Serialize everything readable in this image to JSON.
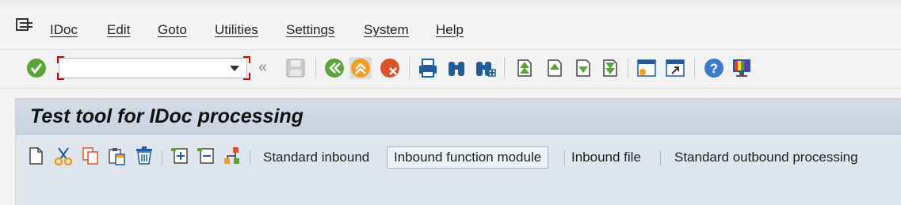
{
  "menubar": {
    "items": [
      "IDoc",
      "Edit",
      "Goto",
      "Utilities",
      "Settings",
      "System",
      "Help"
    ]
  },
  "toolbar": {
    "command_field_value": "",
    "icons": [
      "enter-icon",
      "back-icon",
      "exit-icon",
      "cancel-icon",
      "print-icon",
      "find-icon",
      "find-next-icon",
      "first-page-icon",
      "previous-page-icon",
      "next-page-icon",
      "last-page-icon",
      "create-session-icon",
      "shortcut-icon",
      "help-icon",
      "layout-icon"
    ]
  },
  "panel": {
    "title": "Test tool for IDoc processing",
    "buttons": [
      "Standard inbound",
      "Inbound function module",
      "Inbound file",
      "Standard outbound processing"
    ],
    "active_button": "Inbound function module"
  },
  "colors": {
    "accent_orange": "#f39c1f",
    "enter_green": "#5aa43c",
    "cancel_red": "#d9532b",
    "title_bar_blue": "#cdd6e2",
    "help_blue": "#3b7cc8",
    "command_field_corner": "#cc0000"
  }
}
